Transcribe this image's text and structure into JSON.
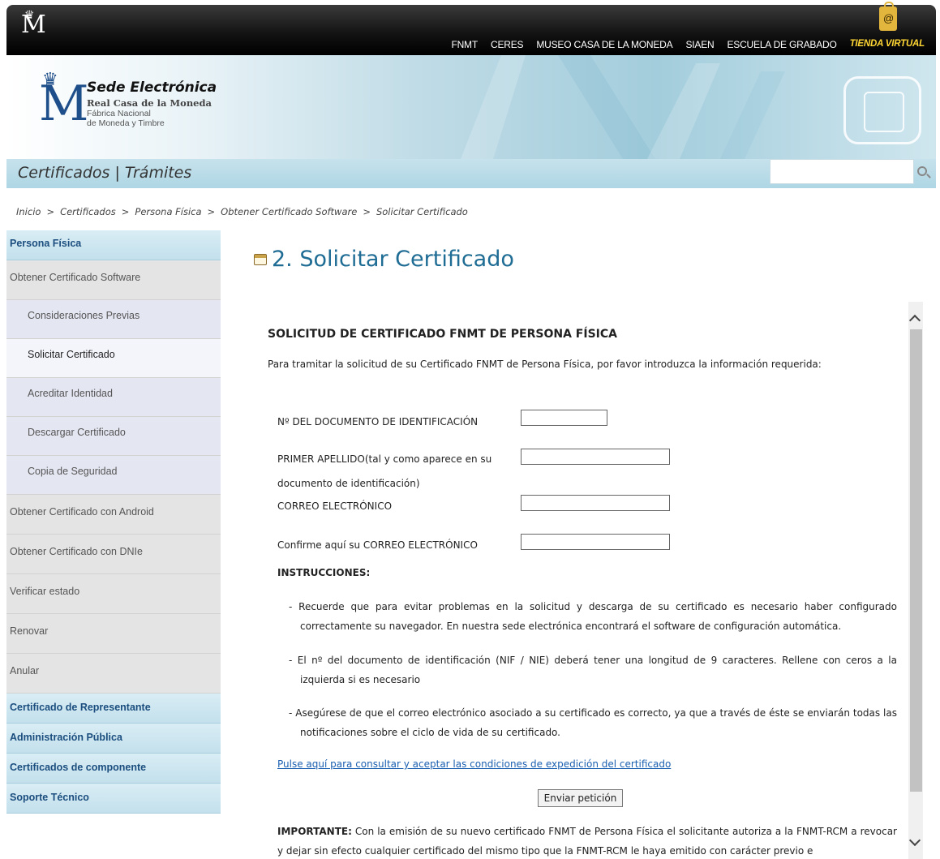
{
  "top": {
    "nav": [
      "FNMT",
      "CERES",
      "MUSEO CASA DE LA MONEDA",
      "SIAEN",
      "ESCUELA DE GRABADO"
    ],
    "tienda": "TIENDA VIRTUAL"
  },
  "brand": {
    "title": "Sede Electrónica",
    "subtitle": "Real Casa de la Moneda",
    "line1": "Fábrica Nacional",
    "line2": "de Moneda y Timbre"
  },
  "subbar": {
    "certificados": "Certificados",
    "separator": "|",
    "tramites": "Trámites"
  },
  "breadcrumb": [
    "Inicio",
    "Certificados",
    "Persona Física",
    "Obtener Certificado Software",
    "Solicitar Certificado"
  ],
  "breadcrumb_sep": ">",
  "sidebar": {
    "header": "Persona Física",
    "obtener_software": "Obtener Certificado Software",
    "sub": [
      "Consideraciones Previas",
      "Solicitar Certificado",
      "Acreditar Identidad",
      "Descargar Certificado",
      "Copia de Seguridad"
    ],
    "level1": [
      "Obtener Certificado con Android",
      "Obtener Certificado con DNIe",
      "Verificar estado",
      "Renovar",
      "Anular"
    ],
    "categories": [
      "Certificado de Representante",
      "Administración Pública",
      "Certificados de componente",
      "Soporte Técnico"
    ]
  },
  "page_title": "2. Solicitar Certificado",
  "form": {
    "heading": "SOLICITUD DE CERTIFICADO FNMT DE PERSONA FÍSICA",
    "intro": "Para tramitar la solicitud de su Certificado FNMT de Persona Física, por favor introduzca la información requerida:",
    "label_doc": "Nº DEL DOCUMENTO DE IDENTIFICACIÓN",
    "label_apellido_1": "PRIMER APELLIDO(tal y como aparece en su",
    "label_apellido_2": "documento de identificación)",
    "label_correo": "CORREO ELECTRÓNICO",
    "label_confirm": "Confirme aquí su CORREO ELECTRÓNICO",
    "instrucciones": "INSTRUCCIONES:",
    "bullets": [
      "- Recuerde que para evitar problemas en la solicitud y descarga de su certificado es necesario haber configurado correctamente su navegador. En nuestra sede electrónica encontrará el software de configuración automática.",
      "- El nº del documento de identificación (NIF / NIE) deberá tener una longitud de 9 caracteres. Rellene con ceros a la izquierda si es necesario",
      "- Asegúrese de que el correo electrónico asociado a su certificado es correcto, ya que a través de éste se enviarán todas las notificaciones sobre el ciclo de vida de su certificado."
    ],
    "link": "Pulse aquí para consultar y aceptar las condiciones de expedición del certificado",
    "submit": "Enviar petición",
    "important_label": "IMPORTANTE:",
    "important_text": " Con la emisión de su nuevo certificado FNMT de Persona Física el solicitante autoriza a la FNMT-RCM a revocar y dejar sin efecto cualquier certificado del mismo tipo que la FNMT-RCM le haya emitido con carácter previo e"
  }
}
